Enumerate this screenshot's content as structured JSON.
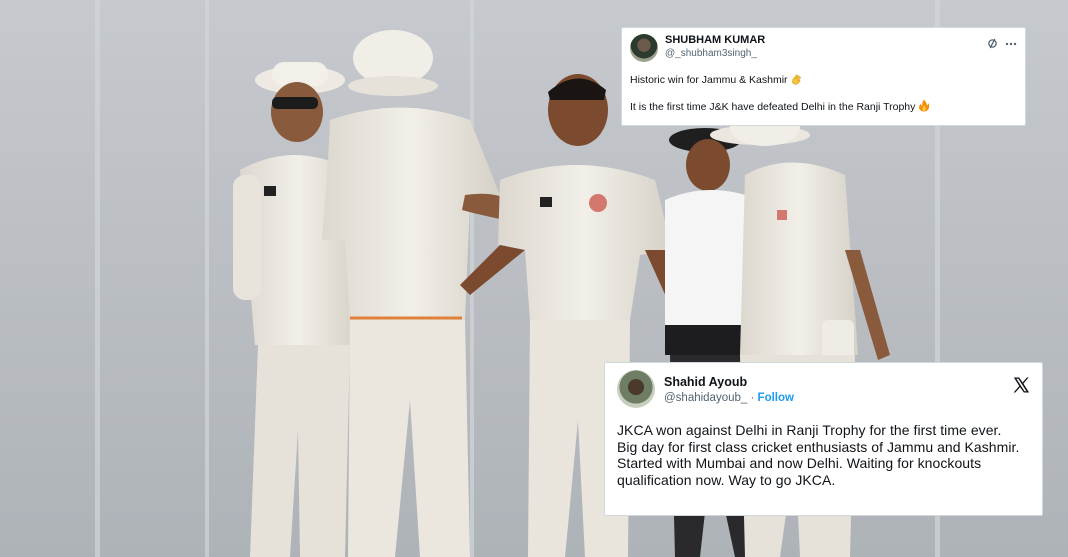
{
  "tweet_top": {
    "name": "SHUBHAM KUMAR",
    "handle": "@_shubham3singh_",
    "refresh_icon": "grok-icon",
    "more_icon": "more-icon",
    "line1": "Historic win for Jammu & Kashmir",
    "line2": "It is the first time J&K have defeated Delhi in the Ranji Trophy"
  },
  "tweet_bottom": {
    "name": "Shahid Ayoub",
    "handle": "@shahidayoub_",
    "separator": "·",
    "follow_label": "Follow",
    "logo_icon": "x-logo-icon",
    "text_para1": "JKCA won against Delhi in Ranji Trophy for the first time ever.",
    "text_para2": "Big day for first class cricket enthusiasts of Jammu and Kashmir. Started with Mumbai and now Delhi. Waiting for knockouts qualification now. Way to go JKCA."
  },
  "colors": {
    "link_blue": "#1d9bf0",
    "text_dark": "#0f1419",
    "text_muted": "#536471",
    "card_border": "#cfd9de"
  }
}
